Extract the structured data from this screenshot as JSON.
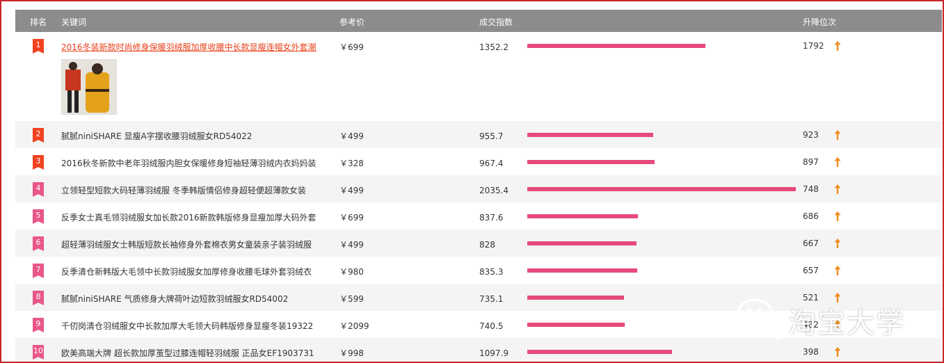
{
  "header": {
    "rank": "排名",
    "keyword": "关键词",
    "price": "参考价",
    "deal_index": "成交指数",
    "change": "升降位次"
  },
  "rows": [
    {
      "rank": "1",
      "keyword": "2016冬装新款时尚修身保暖羽绒服加厚收腰中长款显瘦连帽女外套潮",
      "price": "￥699",
      "deal": "1352.2",
      "change": "1792"
    },
    {
      "rank": "2",
      "keyword": "腻腻niniSHARE 显瘦A字摆收腰羽绒服女RD54022",
      "price": "￥499",
      "deal": "955.7",
      "change": "923"
    },
    {
      "rank": "3",
      "keyword": "2016秋冬新款中老年羽绒服内胆女保暖修身短袖轻薄羽绒内衣妈妈装",
      "price": "￥328",
      "deal": "967.4",
      "change": "897"
    },
    {
      "rank": "4",
      "keyword": "立领轻型短款大码轻薄羽绒服 冬季韩版情侣修身超轻便超薄款女装",
      "price": "￥499",
      "deal": "2035.4",
      "change": "748"
    },
    {
      "rank": "5",
      "keyword": "反季女士真毛领羽绒服女加长款2016新款韩版修身显瘦加厚大码外套",
      "price": "￥699",
      "deal": "837.6",
      "change": "686"
    },
    {
      "rank": "6",
      "keyword": "超轻薄羽绒服女士韩版短款长袖修身外套棉衣男女童装亲子装羽绒服",
      "price": "￥499",
      "deal": "828",
      "change": "667"
    },
    {
      "rank": "7",
      "keyword": "反季清仓新韩版大毛领中长款羽绒服女加厚修身收腰毛球外套羽绒衣",
      "price": "￥980",
      "deal": "835.3",
      "change": "657"
    },
    {
      "rank": "8",
      "keyword": "腻腻niniSHARE 气质修身大牌荷叶边短款羽绒服女RD54002",
      "price": "￥599",
      "deal": "735.1",
      "change": "521"
    },
    {
      "rank": "9",
      "keyword": "千仞岗清仓羽绒服女中长款加厚大毛领大码韩版修身显瘦冬装19322",
      "price": "￥2099",
      "deal": "740.5",
      "change": "482"
    },
    {
      "rank": "10",
      "keyword": "欧美高端大牌 超长款加厚茧型过膝连帽轻羽绒服 正品女EF1903731",
      "price": "￥998",
      "deal": "1097.9",
      "change": "398"
    }
  ],
  "bar_scale_max": 2035.4,
  "watermark": {
    "text": "淘宝大学"
  },
  "colors": {
    "frame_border": "#c9262c",
    "header_bg": "#8c8c8c",
    "rank_top": "#f2421f",
    "rank_other": "#e9568a",
    "bar": "#e64a7a",
    "arrow_up": "#f08c1e",
    "link": "#e8401a"
  },
  "icons": {
    "trend": "arrow-up-icon",
    "watermark_logo": "wechat-icon"
  }
}
